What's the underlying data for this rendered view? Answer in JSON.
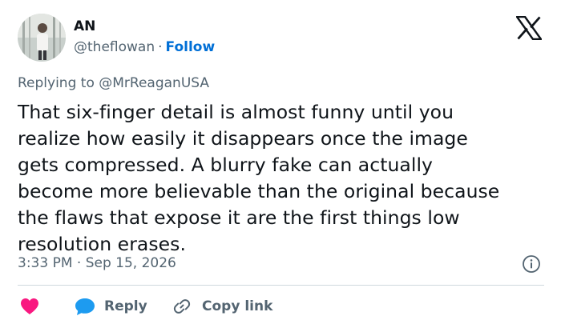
{
  "author": {
    "display_name": "AN",
    "handle": "@theflowan",
    "separator": "·",
    "follow_label": "Follow"
  },
  "reply_context": {
    "prefix": "Replying to",
    "mention": "@MrReaganUSA"
  },
  "tweet": {
    "lines": [
      "That six-finger detail is almost funny until you",
      "realize how easily it disappears once the image",
      "gets compressed. A blurry fake can actually",
      "become more believable than the original because",
      "the flaws that expose it are the first things low",
      "resolution erases."
    ]
  },
  "meta": {
    "time": "3:33 PM",
    "separator": "·",
    "date": "Sep 15, 2026"
  },
  "actions": {
    "reply_label": "Reply",
    "copy_link_label": "Copy link"
  },
  "icons": {
    "logo": "x-logo-icon",
    "info": "info-icon",
    "like": "heart-icon",
    "reply": "speech-bubble-icon",
    "copy": "link-icon"
  },
  "colors": {
    "text": "#0f1419",
    "secondary": "#536471",
    "link": "#006fd6",
    "heart": "#f91880",
    "reply_bubble": "#1d9bf0",
    "divider": "#cfd9de"
  }
}
